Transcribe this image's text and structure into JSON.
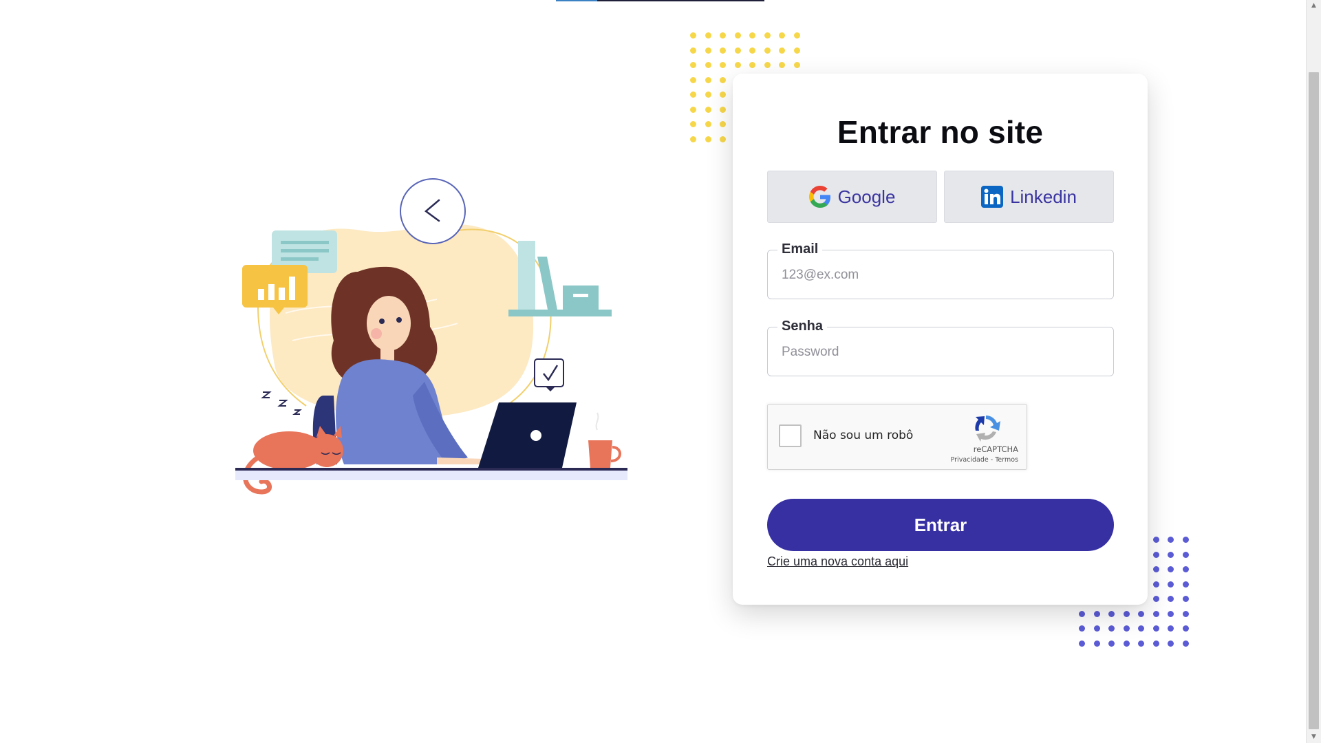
{
  "login": {
    "title": "Entrar no site",
    "social": {
      "google_label": "Google",
      "linkedin_label": "Linkedin"
    },
    "email": {
      "label": "Email",
      "placeholder": "123@ex.com",
      "value": ""
    },
    "password": {
      "label": "Senha",
      "placeholder": "Password",
      "value": ""
    },
    "recaptcha": {
      "label": "Não sou um robô",
      "brand": "reCAPTCHA",
      "privacy": "Privacidade",
      "separator": " - ",
      "terms": "Termos",
      "checked": false
    },
    "submit_label": "Entrar",
    "signup_link": "Crie uma nova conta aqui"
  },
  "icons": {
    "google": "google-icon",
    "linkedin": "linkedin-icon",
    "recaptcha": "recaptcha-icon"
  },
  "colors": {
    "primary": "#3730a3",
    "social_button_bg": "#e6e7eb",
    "social_text": "#3a34a0",
    "dots_yellow": "#f7d74a",
    "dots_blue": "#5b5bd6"
  }
}
